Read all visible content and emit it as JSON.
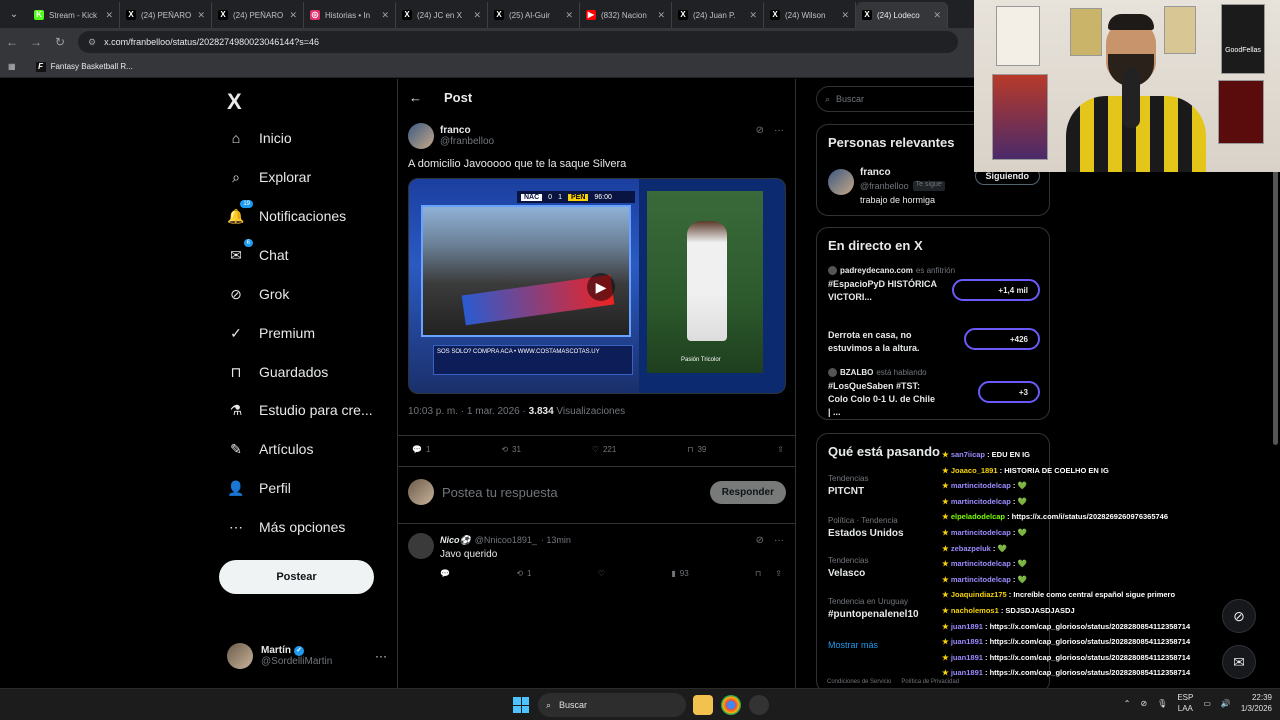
{
  "browser": {
    "tabs": [
      {
        "title": "Stream - Kick",
        "fav": "K",
        "color": "#53fc18"
      },
      {
        "title": "(24) PEÑARO",
        "fav": "X",
        "color": "#000"
      },
      {
        "title": "(24) PEÑARO",
        "fav": "X",
        "color": "#000"
      },
      {
        "title": "Historias • In",
        "fav": "◎",
        "color": "#e1306c"
      },
      {
        "title": "(24) JC en X",
        "fav": "X",
        "color": "#000"
      },
      {
        "title": "(25) Al-Guir",
        "fav": "X",
        "color": "#000"
      },
      {
        "title": "(832) Nacion",
        "fav": "▶",
        "color": "#ff0000"
      },
      {
        "title": "(24) Juan P.",
        "fav": "X",
        "color": "#000"
      },
      {
        "title": "(24) Wilson",
        "fav": "X",
        "color": "#000"
      },
      {
        "title": "(24) Lodeco",
        "fav": "X",
        "color": "#000"
      }
    ],
    "url": "x.com/franbelloo/status/2028274980023046144?s=46",
    "bookmark": "Fantasy Basketball R..."
  },
  "nav": {
    "logo": "X",
    "items": [
      {
        "label": "Inicio",
        "icon": "home-icon",
        "badge": ""
      },
      {
        "label": "Explorar",
        "icon": "search-icon",
        "badge": ""
      },
      {
        "label": "Notificaciones",
        "icon": "bell-icon",
        "badge": "19"
      },
      {
        "label": "Chat",
        "icon": "mail-icon",
        "badge": "6"
      },
      {
        "label": "Grok",
        "icon": "grok-icon",
        "badge": ""
      },
      {
        "label": "Premium",
        "icon": "premium-icon",
        "badge": ""
      },
      {
        "label": "Guardados",
        "icon": "bookmark-icon",
        "badge": ""
      },
      {
        "label": "Estudio para cre...",
        "icon": "studio-icon",
        "badge": ""
      },
      {
        "label": "Artículos",
        "icon": "articles-icon",
        "badge": ""
      },
      {
        "label": "Perfil",
        "icon": "person-icon",
        "badge": ""
      },
      {
        "label": "Más opciones",
        "icon": "more-icon",
        "badge": ""
      }
    ],
    "post_button": "Postear",
    "account": {
      "name": "Martín",
      "handle": "@SordelliMartin"
    }
  },
  "post": {
    "header": "Post",
    "author": {
      "name": "franco",
      "handle": "@franbelloo"
    },
    "text": "A domicilio Javooooo que te la saque Silvera",
    "media": {
      "score": {
        "home": "NAC",
        "home_goals": "0",
        "away_goals": "1",
        "away": "PEÑ",
        "clock": "96:00"
      },
      "ad_text": "SOS SOLO? COMPRA ACA • WWW.COSTAMASCOTAS.UY",
      "tag": "Pasión Tricolor"
    },
    "time": "10:03 p. m. · 1 mar. 2026 · ",
    "views_count": "3.834",
    "views_label": " Visualizaciones",
    "actions": {
      "replies": "1",
      "reposts": "31",
      "likes": "221",
      "bookmarks": "39"
    },
    "reply_placeholder": "Postea tu respuesta",
    "reply_button": "Responder"
  },
  "comment": {
    "name": "Nico⚽",
    "handle": "@Nnicoo1891_",
    "time": "· 13min",
    "text": "Javo querido",
    "reposts": "1",
    "views": "93"
  },
  "sidebar": {
    "search_placeholder": "Buscar",
    "relevant": {
      "title": "Personas relevantes",
      "name": "franco",
      "handle": "@franbelloo",
      "follows_you": "Te sigue",
      "bio": "trabajo de hormiga",
      "button": "Siguiendo"
    },
    "live": {
      "title": "En directo en X",
      "items": [
        {
          "host": "padreydecano.com",
          "role": "es anfitrión",
          "title": "#EspacioPyD HISTÓRICA VICTORI...",
          "count": "+1,4 mil"
        },
        {
          "host": "",
          "role": "",
          "title": "Derrota en casa, no estuvimos a la altura.",
          "count": "+426"
        },
        {
          "host": "BZALBO",
          "role": "está hablando",
          "title": "#LosQueSaben #TST: Colo Colo 0-1 U. de Chile | ...",
          "count": "+3"
        }
      ]
    },
    "trends": {
      "title": "Qué está pasando",
      "items": [
        {
          "context": "Tendencias",
          "name": "PITCNT"
        },
        {
          "context": "Política · Tendencia",
          "name": "Estados Unidos"
        },
        {
          "context": "Tendencias",
          "name": "Velasco"
        },
        {
          "context": "Tendencia en Uruguay",
          "name": "#puntopenalenel10"
        }
      ],
      "show_more": "Mostrar más"
    },
    "footer": [
      "Condiciones de Servicio",
      "Política de Privacidad"
    ]
  },
  "chat": [
    {
      "user": "san7iicap",
      "msg": "EDU EN IG",
      "color": "#9b8cff"
    },
    {
      "user": "Joaaco_1891",
      "msg": "HISTORIA DE COELHO EN IG",
      "color": "#f5d20a"
    },
    {
      "user": "martincitodelcap",
      "msg": "💚",
      "color": "#9b8cff"
    },
    {
      "user": "martincitodelcap",
      "msg": "💚",
      "color": "#9b8cff"
    },
    {
      "user": "elpeladodelcap",
      "msg": "https://x.com/i/status/2028269260976365746",
      "color": "#7cfc00"
    },
    {
      "user": "martincitodelcap",
      "msg": "💚",
      "color": "#9b8cff"
    },
    {
      "user": "zebazpeluk",
      "msg": "💚",
      "color": "#9b8cff"
    },
    {
      "user": "martincitodelcap",
      "msg": "💚",
      "color": "#9b8cff"
    },
    {
      "user": "martincitodelcap",
      "msg": "💚",
      "color": "#9b8cff"
    },
    {
      "user": "Joaquindiaz175",
      "msg": "Increíble como central español sigue primero",
      "color": "#f5d20a"
    },
    {
      "user": "nacholemos1",
      "msg": "SDJSDJASDJASDJ",
      "color": "#f5d20a"
    },
    {
      "user": "juan1891",
      "msg": "https://x.com/cap_glorioso/status/2028280854112358714",
      "color": "#9b8cff"
    },
    {
      "user": "juan1891",
      "msg": "https://x.com/cap_glorioso/status/2028280854112358714",
      "color": "#9b8cff"
    },
    {
      "user": "juan1891",
      "msg": "https://x.com/cap_glorioso/status/2028280854112358714",
      "color": "#9b8cff"
    },
    {
      "user": "juan1891",
      "msg": "https://x.com/cap_glorioso/status/2028280854112358714",
      "color": "#9b8cff"
    }
  ],
  "webcam": {
    "poster_label": "GoodFellas"
  },
  "taskbar": {
    "search": "Buscar",
    "lang": "ESP",
    "lang2": "LAA",
    "time": "22:39",
    "date": "1/3/2026"
  }
}
